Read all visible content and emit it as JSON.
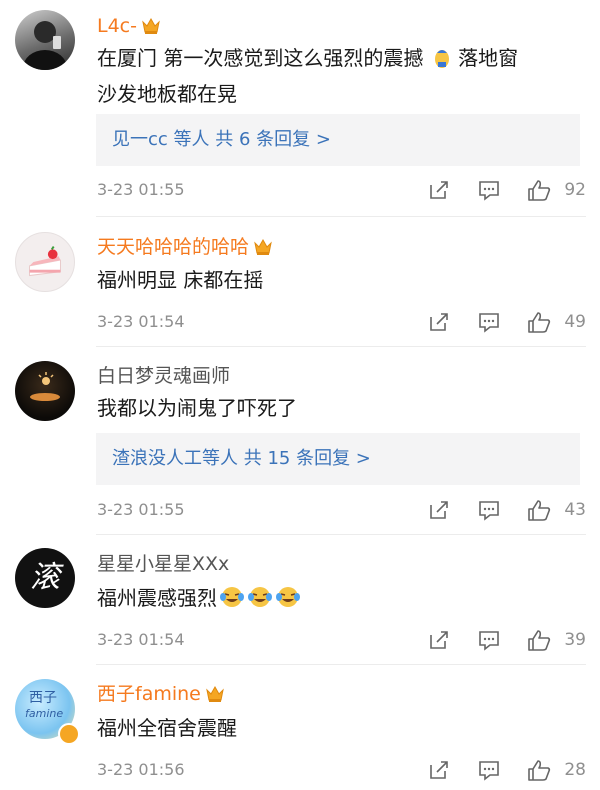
{
  "comments": [
    {
      "name": "L4c-",
      "text_lines": [
        "在厦门 第一次感觉到这么强烈的震撼",
        "沙发地板都在晃"
      ],
      "text_suffix": "落地窗",
      "reply": "见一cc 等人  共 6 条回复 >",
      "time": "3-23 01:55",
      "likes": "92"
    },
    {
      "name": "天天哈哈哈的哈哈",
      "text": "福州明显 床都在摇",
      "time": "3-23 01:54",
      "likes": "49"
    },
    {
      "name": "白日梦灵魂画师",
      "text": "我都以为闹鬼了吓死了",
      "reply": "渣浪没人工等人  共 15 条回复 >",
      "time": "3-23 01:55",
      "likes": "43"
    },
    {
      "name": "星星小星星XXx",
      "text": "福州震感强烈",
      "avatar_glyph": "滚",
      "time": "3-23 01:54",
      "likes": "39"
    },
    {
      "name": "西子famine",
      "text": "福州全宿舍震醒",
      "avatar_text": "西子",
      "avatar_text2": "famine",
      "time": "3-23 01:56",
      "likes": "28"
    }
  ],
  "colors": {
    "vip_name": "#f57a1f",
    "link": "#3b73b9",
    "meta": "#8f8f8f"
  },
  "icons": {
    "share": "share-icon",
    "comment": "comment-icon",
    "like": "like-icon",
    "crown": "vip-crown-icon"
  }
}
